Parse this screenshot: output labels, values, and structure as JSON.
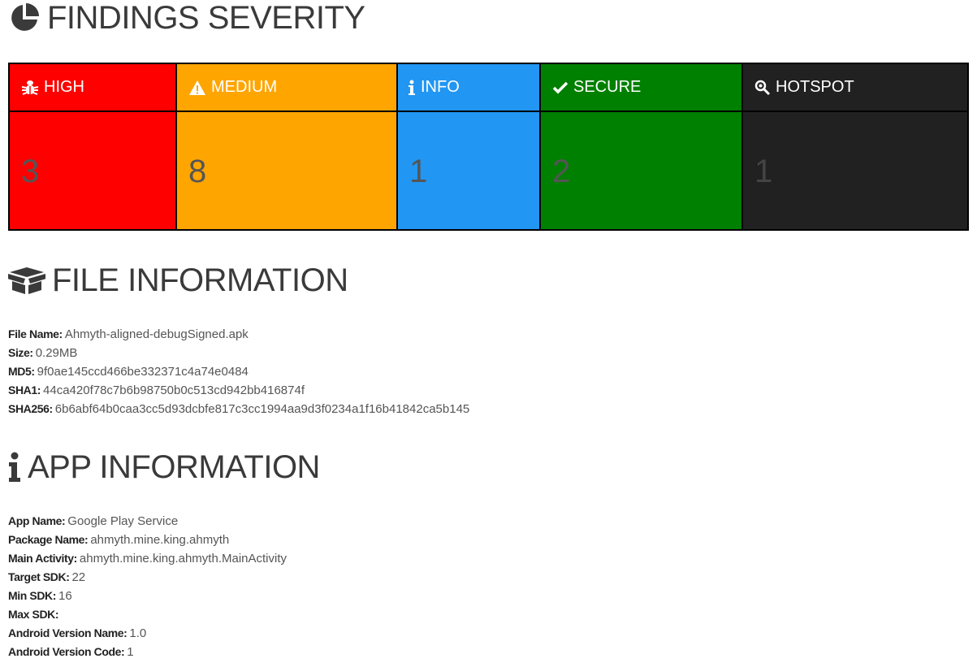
{
  "severity": {
    "title": "FINDINGS SEVERITY",
    "icon": "pie-chart-icon",
    "columns": [
      {
        "label": "HIGH",
        "count": "3",
        "icon": "bug-icon",
        "color": "#ff0000"
      },
      {
        "label": "MEDIUM",
        "count": "8",
        "icon": "warning-icon",
        "color": "#ffa500"
      },
      {
        "label": "INFO",
        "count": "1",
        "icon": "info-icon",
        "color": "#2196f3"
      },
      {
        "label": "SECURE",
        "count": "2",
        "icon": "check-icon",
        "color": "#008000"
      },
      {
        "label": "HOTSPOT",
        "count": "1",
        "icon": "search-icon",
        "color": "#212121"
      }
    ]
  },
  "file_info": {
    "title": "FILE INFORMATION",
    "icon": "box-open-icon",
    "rows": [
      {
        "key": "File Name:",
        "value": "Ahmyth-aligned-debugSigned.apk"
      },
      {
        "key": "Size:",
        "value": "0.29MB"
      },
      {
        "key": "MD5:",
        "value": "9f0ae145ccd466be332371c4a74e0484"
      },
      {
        "key": "SHA1:",
        "value": "44ca420f78c7b6b98750b0c513cd942bb416874f"
      },
      {
        "key": "SHA256:",
        "value": "6b6abf64b0caa3cc5d93dcbfe817c3cc1994aa9d3f0234a1f16b41842ca5b145"
      }
    ]
  },
  "app_info": {
    "title": "APP INFORMATION",
    "icon": "info-icon",
    "rows": [
      {
        "key": "App Name:",
        "value": "Google Play Service"
      },
      {
        "key": "Package Name:",
        "value": "ahmyth.mine.king.ahmyth"
      },
      {
        "key": "Main Activity:",
        "value": "ahmyth.mine.king.ahmyth.MainActivity"
      },
      {
        "key": "Target SDK:",
        "value": "22"
      },
      {
        "key": "Min SDK:",
        "value": "16"
      },
      {
        "key": "Max SDK:",
        "value": ""
      },
      {
        "key": "Android Version Name:",
        "value": "1.0"
      },
      {
        "key": "Android Version Code:",
        "value": "1"
      }
    ]
  }
}
